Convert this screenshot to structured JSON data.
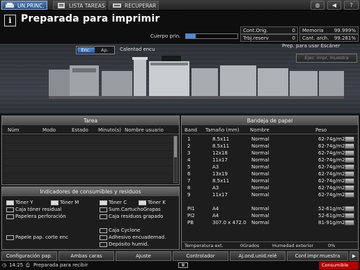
{
  "tabs": [
    {
      "label": "UN.PRINC."
    },
    {
      "label": "LISTA TAREAS"
    },
    {
      "label": "RECUPERAR"
    }
  ],
  "status": {
    "title": "Preparada para imprimir",
    "cuerpo_label": "Cuerpo prin."
  },
  "counters": {
    "cont_orig_label": "Cont.Orig.",
    "cont_orig_value": "0",
    "trbj_reserv_label": "Trbj.reserv",
    "trbj_reserv_value": "0",
    "memoria_label": "Memoria",
    "memoria_value": "99.999%",
    "cant_arch_label": "Cant. arch.",
    "cant_arch_value": "99.281%"
  },
  "machine": {
    "enc_label": "Enc.",
    "ap_label": "Ap.",
    "calentad_label": "Calentad encu",
    "scanner_status": "Prep. para usar Escáner",
    "ejec_button": "Ejec. impr. muestra"
  },
  "tarea": {
    "title": "Tarea",
    "columns": [
      "Núm",
      "Modo",
      "Estado",
      "Minuto(s)",
      "Nombre usuario"
    ]
  },
  "consumibles": {
    "title": "Indicadores de consumibles y residuos",
    "items": [
      "Tóner Y",
      "Tóner M",
      "Tóner C",
      "Tóner K",
      "Caja tóner residual",
      "Sum.CartuchoGrapas",
      "Papelera perforación",
      "Caja residuos grapado",
      "Caja Cyclone",
      "Papele pap. corte enc",
      "Adhesivo encuadernad.",
      "Depósito humid."
    ]
  },
  "bandeja": {
    "title": "Bandeja de papel",
    "columns": [
      "Band",
      "Tamaño (mm)",
      "Nombre",
      "Peso"
    ],
    "rows": [
      {
        "band": "1",
        "size": "8.5x11",
        "name": "Normal",
        "weight": "62-74g/m2"
      },
      {
        "band": "2",
        "size": "8.5x11",
        "name": "Normal",
        "weight": "62-74g/m2"
      },
      {
        "band": "3",
        "size": "12x18",
        "name": "Normal",
        "weight": "62-74g/m2"
      },
      {
        "band": "4",
        "size": "11x17",
        "name": "Normal",
        "weight": "62-74g/m2"
      },
      {
        "band": "5",
        "size": "A3",
        "name": "Normal",
        "weight": "62-74g/m2"
      },
      {
        "band": "6",
        "size": "13x19",
        "name": "Normal",
        "weight": "62-74g/m2"
      },
      {
        "band": "7",
        "size": "8.5x11",
        "name": "Normal",
        "weight": "62-74g/m2"
      },
      {
        "band": "8",
        "size": "A3",
        "name": "Normal",
        "weight": "62-74g/m2"
      },
      {
        "band": "9",
        "size": "11x17",
        "name": "Normal",
        "weight": "62-74g/m2"
      },
      {
        "band": "PI1",
        "size": "A4",
        "name": "Normal",
        "weight": "52-61g/m2"
      },
      {
        "band": "PI2",
        "size": "A4",
        "name": "Normal",
        "weight": "52-61g/m2"
      },
      {
        "band": "PB",
        "size": "307.0 x 472.0",
        "name": "Normal",
        "weight": "81-91g/m2"
      }
    ],
    "temp_label": "Temperatura ext.",
    "temp_value": "0Grados",
    "hum_label": "Humedad exterior",
    "hum_value": "0%"
  },
  "bottom_tabs": [
    "Configuración pap.",
    "Ambas caras",
    "Ajuste",
    "Controlador",
    "Aj.ond.unid.relé",
    "Conf.impr.muestra"
  ],
  "footer": {
    "time": "14:25",
    "status": "Preparada para recibir",
    "consumible": "Consumible"
  }
}
